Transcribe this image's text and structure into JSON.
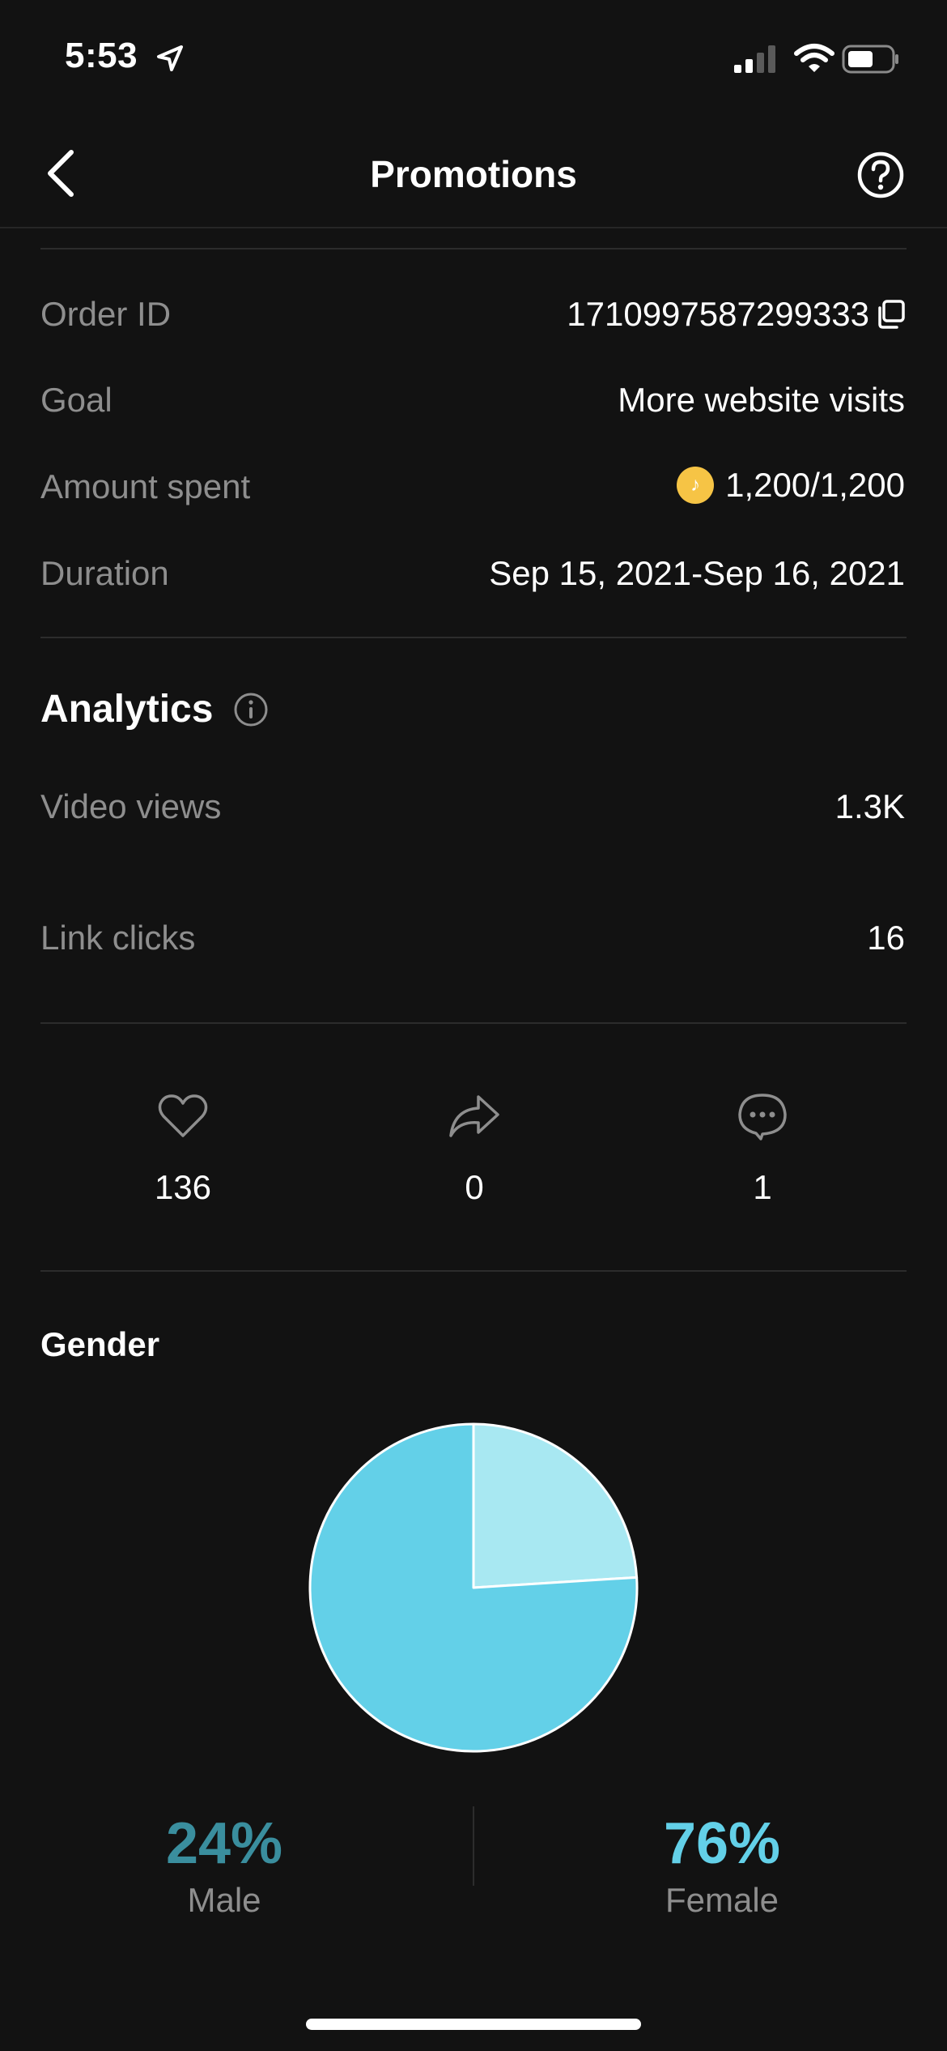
{
  "status_bar": {
    "time": "5:53"
  },
  "header": {
    "title": "Promotions"
  },
  "details": {
    "order_id": {
      "label": "Order ID",
      "value": "1710997587299333"
    },
    "goal": {
      "label": "Goal",
      "value": "More website visits"
    },
    "amount_spent": {
      "label": "Amount spent",
      "value": "1,200/1,200"
    },
    "duration": {
      "label": "Duration",
      "value": "Sep 15, 2021-Sep 16, 2021"
    }
  },
  "analytics": {
    "title": "Analytics",
    "video_views": {
      "label": "Video views",
      "value": "1.3K"
    },
    "link_clicks": {
      "label": "Link clicks",
      "value": "16"
    }
  },
  "engagement": {
    "likes": "136",
    "shares": "0",
    "comments": "1"
  },
  "gender": {
    "title": "Gender",
    "male": {
      "percent": "24%",
      "label": "Male"
    },
    "female": {
      "percent": "76%",
      "label": "Female"
    }
  },
  "colors": {
    "male": "#a8e8f2",
    "female": "#63d0e8",
    "male_text": "#3a8e9e",
    "female_text": "#63d0e8"
  },
  "chart_data": {
    "type": "pie",
    "categories": [
      "Male",
      "Female"
    ],
    "values": [
      24,
      76
    ]
  }
}
